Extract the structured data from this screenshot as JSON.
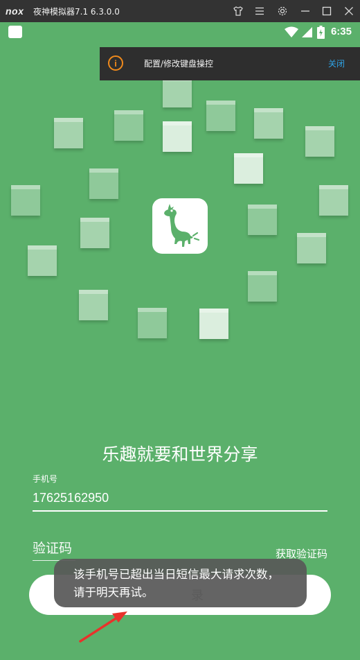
{
  "window": {
    "logo_text": "nox",
    "title": "夜神模拟器7.1 6.3.0.0",
    "buttons": [
      "shirt-icon",
      "menu-icon",
      "gear-icon",
      "minimize-icon",
      "maximize-icon",
      "close-icon"
    ]
  },
  "status_bar": {
    "time": "6:35",
    "icons": [
      "wifi-icon",
      "signal-icon",
      "battery-icon"
    ]
  },
  "banner": {
    "icon": "info-icon",
    "icon_glyph": "i",
    "text": "配置/修改键盘操控",
    "close_label": "关闭",
    "accent_color": "#f08a1c",
    "link_color": "#2fa3e6"
  },
  "app": {
    "background_color": "#5bb06b",
    "slogan": "乐趣就要和世界分享",
    "phone_label": "手机号",
    "phone_value": "17625162950",
    "code_placeholder": "验证码",
    "get_code_label": "获取验证码",
    "login_label": "登录",
    "login_label_visible": "录"
  },
  "toast": {
    "message": "该手机号已超出当日短信最大请求次数，请于明天再试。"
  }
}
